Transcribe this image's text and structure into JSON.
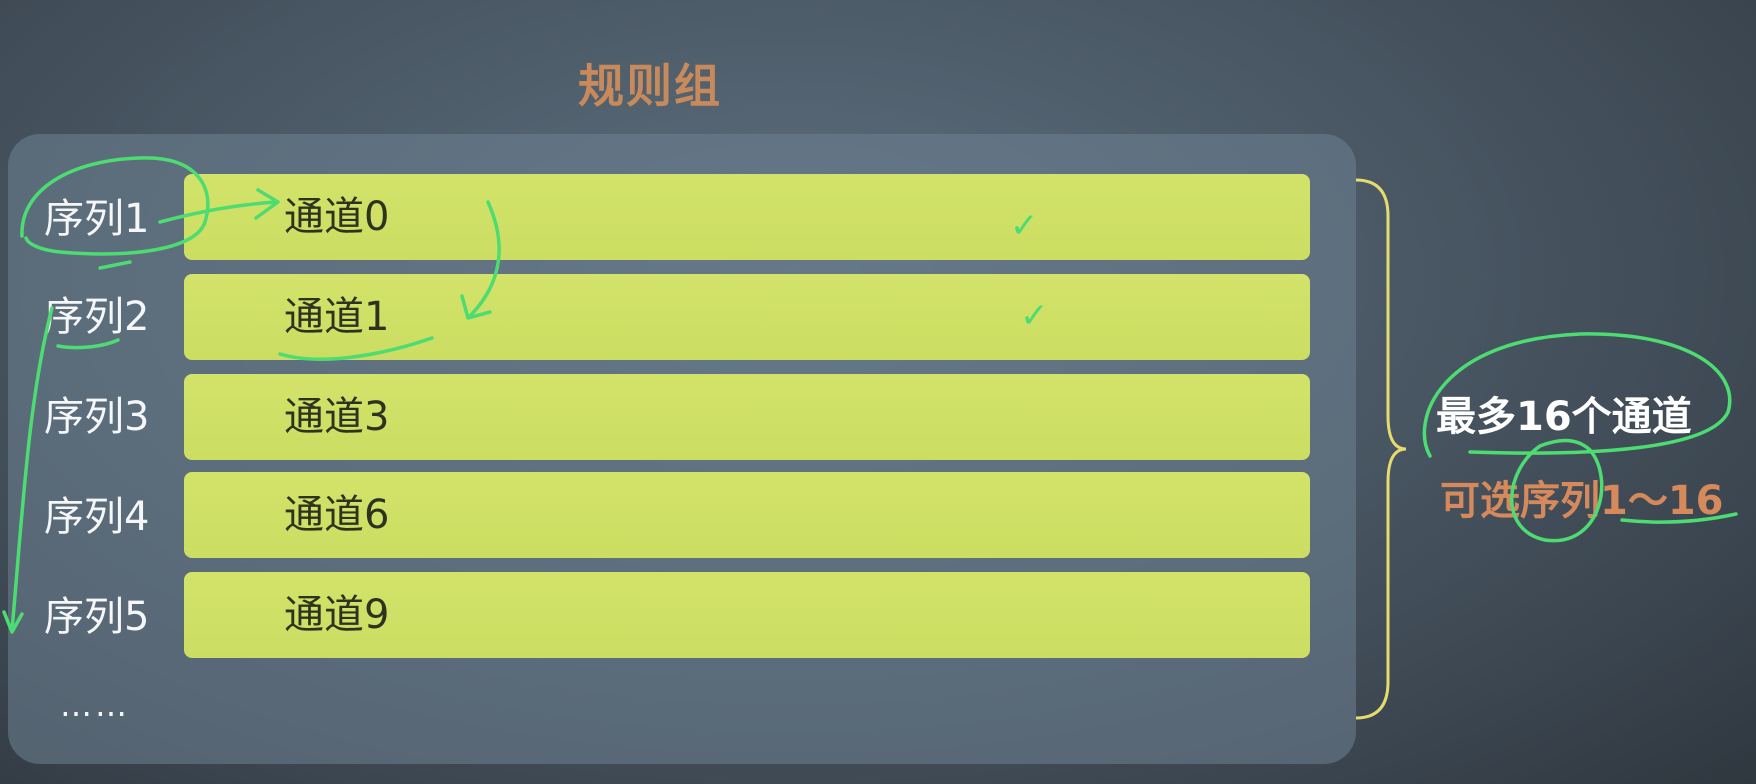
{
  "title": "规则组",
  "rows": [
    {
      "sequence": "序列1",
      "channel": "通道0",
      "checked": true
    },
    {
      "sequence": "序列2",
      "channel": "通道1",
      "checked": true
    },
    {
      "sequence": "序列3",
      "channel": "通道3",
      "checked": false
    },
    {
      "sequence": "序列4",
      "channel": "通道6",
      "checked": false
    },
    {
      "sequence": "序列5",
      "channel": "通道9",
      "checked": false
    }
  ],
  "ellipsis": "……",
  "notes": {
    "max_channels": "最多16个通道",
    "selectable_sequences": "可选序列1～16"
  },
  "colors": {
    "bar": "#cfe065",
    "title": "#c98a5b",
    "annotation_ink": "#4cdc72",
    "brace": "#e6dc6e"
  },
  "icons": {
    "check": "check-mark-icon"
  }
}
